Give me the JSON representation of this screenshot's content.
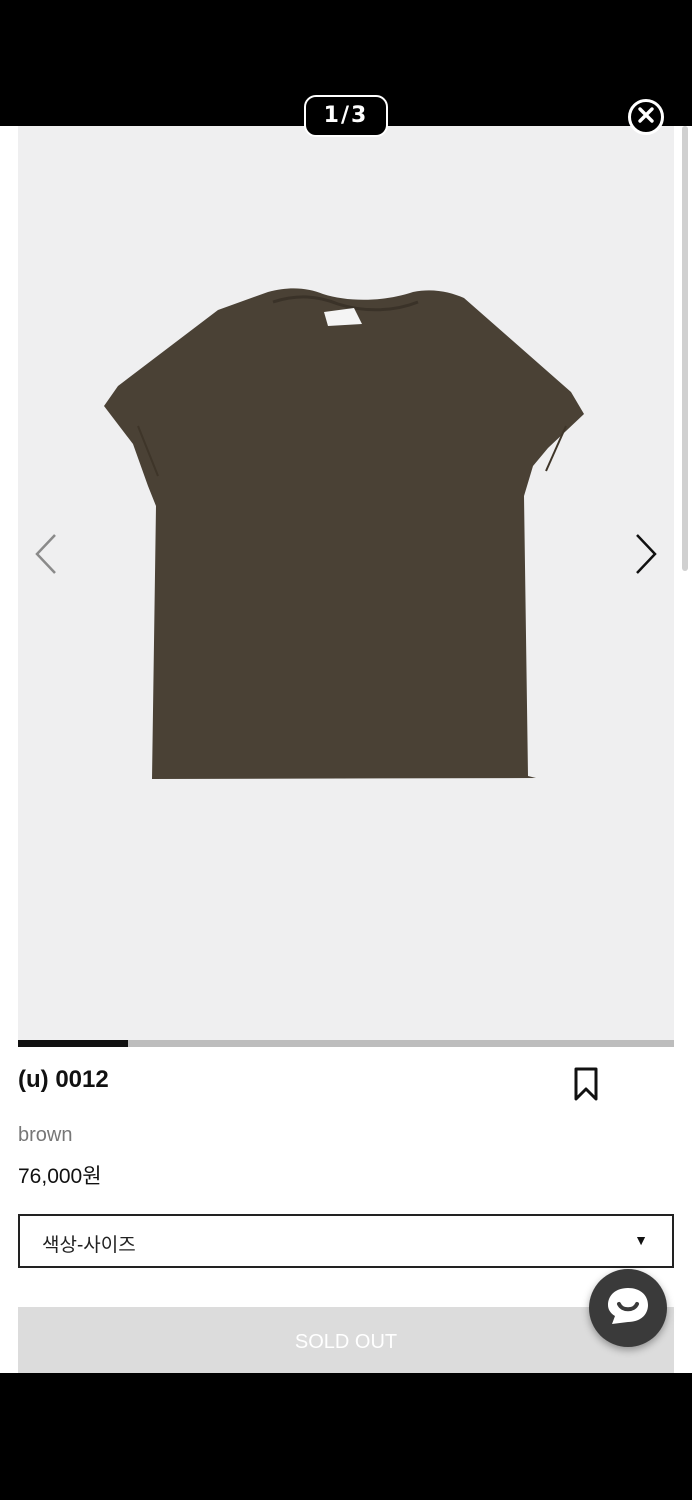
{
  "viewer": {
    "counter": "1/3",
    "close_icon": "close-icon"
  },
  "gallery": {
    "current_index": 1,
    "total": 3,
    "progress_fraction": 0.167,
    "background_color": "#efeff0",
    "prev_icon": "chevron-left-icon",
    "next_icon": "chevron-right-icon"
  },
  "product": {
    "name": "(u) 0012",
    "color": "brown",
    "price": "76,000원",
    "image_color": "#4a4135",
    "bookmark_icon": "bookmark-icon"
  },
  "options": {
    "selected": "색상-사이즈"
  },
  "purchase": {
    "button_label": "SOLD OUT"
  },
  "chat": {
    "icon": "chat-bubble-icon"
  }
}
